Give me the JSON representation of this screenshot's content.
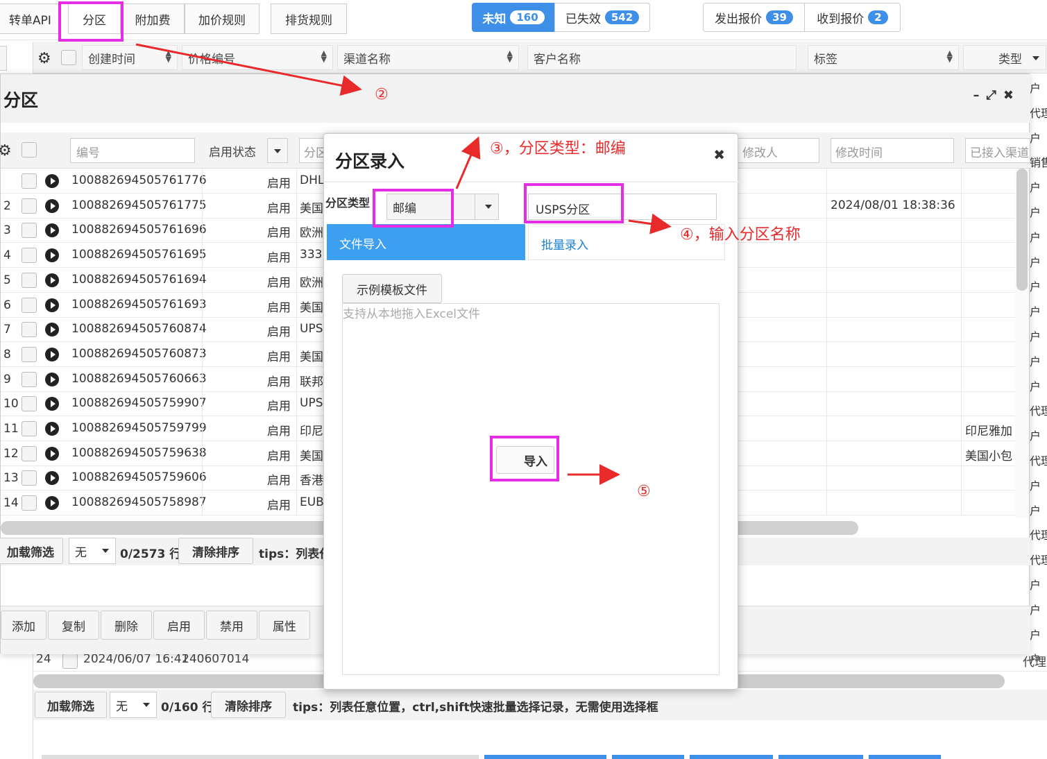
{
  "tabs": [
    "转单API",
    "分区",
    "附加费",
    "加价规则",
    "排货规则"
  ],
  "status": {
    "unknown_label": "未知",
    "unknown_count": "160",
    "invalid_label": "已失效",
    "invalid_count": "542",
    "sent_label": "发出报价",
    "sent_count": "39",
    "recv_label": "收到报价",
    "recv_count": "2"
  },
  "bg_header": {
    "created": "创建时间",
    "price_no": "价格编号",
    "channel": "渠道名称",
    "customer": "客户名称",
    "tag": "标签",
    "type": "类型"
  },
  "panel": {
    "title": "分区"
  },
  "grid_head": {
    "id_placeholder": "编号",
    "status": "启用状态",
    "zone": "分区",
    "modifier": "修改人",
    "modified": "修改时间",
    "channels": "已接入渠道"
  },
  "rows": [
    {
      "n": "",
      "id": "100882694505761776",
      "st": "启用",
      "zn": "DHL",
      "mt": "",
      "ch": ""
    },
    {
      "n": "2",
      "id": "100882694505761775",
      "st": "启用",
      "zn": "美国",
      "mt": "2024/08/01 18:38:36",
      "ch": ""
    },
    {
      "n": "3",
      "id": "100882694505761696",
      "st": "启用",
      "zn": "欧洲",
      "mt": "",
      "ch": ""
    },
    {
      "n": "4",
      "id": "100882694505761695",
      "st": "启用",
      "zn": "333",
      "mt": "",
      "ch": ""
    },
    {
      "n": "5",
      "id": "100882694505761694",
      "st": "启用",
      "zn": "欧洲",
      "mt": "",
      "ch": ""
    },
    {
      "n": "6",
      "id": "100882694505761693",
      "st": "启用",
      "zn": "美国",
      "mt": "",
      "ch": ""
    },
    {
      "n": "7",
      "id": "100882694505760874",
      "st": "启用",
      "zn": "UPS",
      "mt": "",
      "ch": ""
    },
    {
      "n": "8",
      "id": "100882694505760873",
      "st": "启用",
      "zn": "美国",
      "mt": "",
      "ch": ""
    },
    {
      "n": "9",
      "id": "100882694505760663",
      "st": "启用",
      "zn": "联邦",
      "mt": "",
      "ch": ""
    },
    {
      "n": "10",
      "id": "100882694505759907",
      "st": "启用",
      "zn": "UPS",
      "mt": "",
      "ch": ""
    },
    {
      "n": "11",
      "id": "100882694505759799",
      "st": "启用",
      "zn": "印尼",
      "mt": "",
      "ch": "印尼雅加"
    },
    {
      "n": "12",
      "id": "100882694505759638",
      "st": "启用",
      "zn": "美国",
      "mt": "",
      "ch": "美国小包"
    },
    {
      "n": "13",
      "id": "100882694505759606",
      "st": "启用",
      "zn": "香港",
      "mt": "",
      "ch": ""
    },
    {
      "n": "14",
      "id": "100882694505758987",
      "st": "启用",
      "zn": "EUB",
      "mt": "",
      "ch": ""
    }
  ],
  "panel_footer": {
    "load": "加载筛选",
    "none": "无",
    "count": "0/2573 行",
    "clear": "清除排序",
    "tips": "tips：列表任"
  },
  "panel_actions": [
    "添加",
    "复制",
    "删除",
    "启用",
    "禁用",
    "属性"
  ],
  "bg_row": {
    "n": "24",
    "time": "2024/06/07 16:41",
    "code": "240607014",
    "type": "代理"
  },
  "bg_footer": {
    "load": "加载筛选",
    "none": "无",
    "count": "0/160 行",
    "clear": "清除排序",
    "tips": "tips：列表任意位置，ctrl,shift快速批量选择记录，无需使用选择框"
  },
  "dialog": {
    "title": "分区录入",
    "type_label": "分区类型",
    "type_value": "邮编",
    "name_value": "USPS分区",
    "tab_file": "文件导入",
    "tab_batch": "批量录入",
    "template_btn": "示例模板文件",
    "drop_hint": "支持从本地拖入Excel文件",
    "import_btn": "导入"
  },
  "annotations": {
    "a2": "②",
    "a3": "③，分区类型：邮编",
    "a4": "④，输入分区名称",
    "a5": "⑤"
  },
  "right_col": [
    "户",
    "代理",
    "户",
    "销售",
    "户",
    "户",
    "户",
    "户",
    "户",
    "户",
    "户",
    "户",
    "户",
    "代理",
    "户",
    "代理",
    "户",
    "户",
    "代理",
    "代理",
    "户",
    "户",
    "户",
    "户",
    "户"
  ],
  "colors": {
    "accent": "#3d8fe8",
    "annotation": "#e82a2a",
    "highlight": "#e52de5"
  }
}
